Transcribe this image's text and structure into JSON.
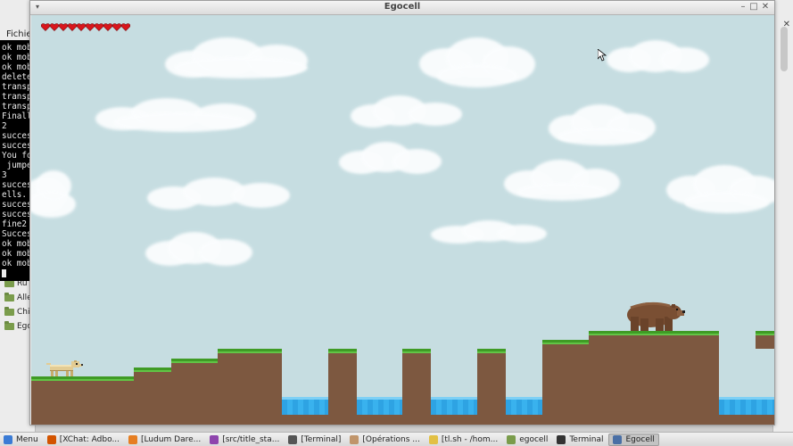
{
  "game_window": {
    "title": "Egocell",
    "health_hearts": 10
  },
  "background_app": {
    "menu_label": "Fichie",
    "tree_items": [
      "Ru",
      "Alle",
      "Chi",
      "Ego"
    ]
  },
  "terminal": {
    "lines": [
      "ok mob",
      "ok mob",
      "ok mob",
      "delete",
      "transp",
      "transp",
      "transp",
      "Finall",
      "2",
      "succes",
      "succes",
      "You fo",
      " jumpe",
      "3",
      "succes",
      "ells.",
      "succes",
      "succes",
      "fine2",
      "Succes",
      "ok mob",
      "ok mob",
      "ok mob"
    ]
  },
  "taskbar": {
    "items": [
      {
        "label": "Menu",
        "icon": "menu-icon",
        "color": "#3a7bd5"
      },
      {
        "label": "[XChat: Adbo...",
        "icon": "xchat-icon",
        "color": "#d35400"
      },
      {
        "label": "[Ludum Dare...",
        "icon": "browser-icon",
        "color": "#e67e22"
      },
      {
        "label": "[src/title_sta...",
        "icon": "editor-icon",
        "color": "#8e44ad"
      },
      {
        "label": "[Terminal]",
        "icon": "terminal-icon",
        "color": "#555555"
      },
      {
        "label": "[Opérations ...",
        "icon": "file-ops-icon",
        "color": "#c0956b"
      },
      {
        "label": "[tl.sh - /hom...",
        "icon": "script-icon",
        "color": "#e2c044"
      },
      {
        "label": "egocell",
        "icon": "folder-icon",
        "color": "#7a9c4b"
      },
      {
        "label": "Terminal",
        "icon": "terminal-icon",
        "color": "#333333"
      },
      {
        "label": "Egocell",
        "icon": "game-icon",
        "color": "#4a6fa5"
      }
    ]
  },
  "colors": {
    "sky": "#c6dde1",
    "grass": "#3f9b25",
    "dirt": "#7d5840",
    "water": "#2ea3e3",
    "heart": "#d9161c"
  }
}
